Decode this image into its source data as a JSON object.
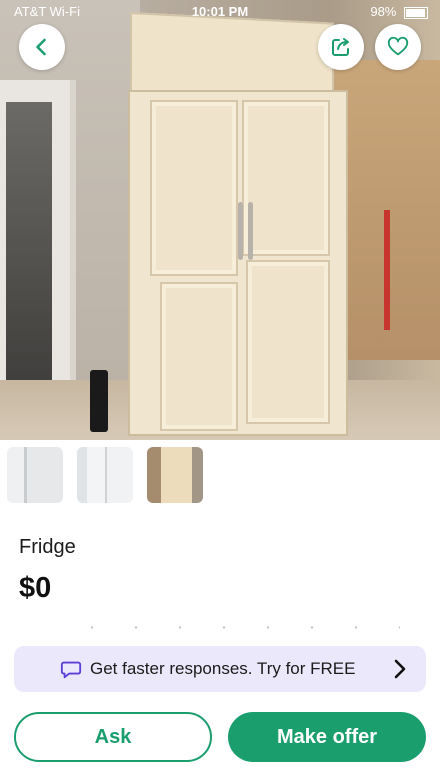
{
  "status_bar": {
    "carrier": "AT&T Wi-Fi",
    "time": "10:01 PM",
    "battery": "98%"
  },
  "hero": {
    "back_icon": "chevron-left-icon",
    "share_icon": "share-icon",
    "favorite_icon": "heart-icon"
  },
  "thumbnails": [
    {
      "alt": "thumbnail-1"
    },
    {
      "alt": "thumbnail-2"
    },
    {
      "alt": "thumbnail-3"
    }
  ],
  "listing": {
    "title": "Fridge",
    "price": "$0"
  },
  "promo": {
    "icon": "chat-bubble-icon",
    "text": "Get faster responses. Try for FREE",
    "chevron": "chevron-right-icon"
  },
  "actions": {
    "ask_label": "Ask",
    "offer_label": "Make offer"
  },
  "colors": {
    "accent": "#1a9e6e",
    "promo_bg": "#ece8fb"
  }
}
